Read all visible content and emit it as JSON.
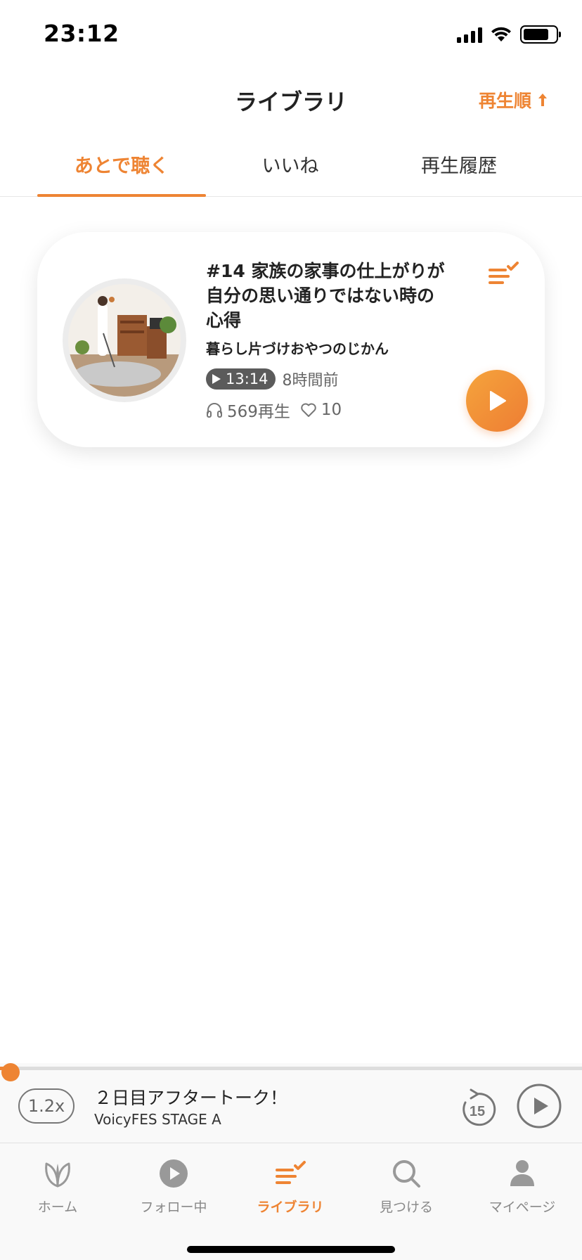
{
  "status_bar": {
    "time": "23:12"
  },
  "header": {
    "title": "ライブラリ",
    "sort_label": "再生順"
  },
  "tabs": [
    {
      "label": "あとで聴く",
      "active": true
    },
    {
      "label": "いいね",
      "active": false
    },
    {
      "label": "再生履歴",
      "active": false
    }
  ],
  "episodes": [
    {
      "title": "#14 家族の家事の仕上がりが自分の思い通りではない時の心得",
      "channel": "暮らし片づけおやつのじかん",
      "duration": "13:14",
      "posted": "8時間前",
      "plays": "569再生",
      "likes": "10"
    }
  ],
  "mini_player": {
    "speed": "1.2x",
    "title": "２日目アフタートーク！",
    "channel": "VoicyFES STAGE A",
    "skip_seconds": "15",
    "progress": 0.01
  },
  "tab_bar": [
    {
      "label": "ホーム",
      "icon": "leaf-icon",
      "active": false
    },
    {
      "label": "フォロー中",
      "icon": "play-circle-icon",
      "active": false
    },
    {
      "label": "ライブラリ",
      "icon": "playlist-check-icon",
      "active": true
    },
    {
      "label": "見つける",
      "icon": "search-icon",
      "active": false
    },
    {
      "label": "マイページ",
      "icon": "person-icon",
      "active": false
    }
  ],
  "colors": {
    "accent": "#ee8433",
    "inactive": "#888888",
    "badge": "#5b5b5b"
  }
}
